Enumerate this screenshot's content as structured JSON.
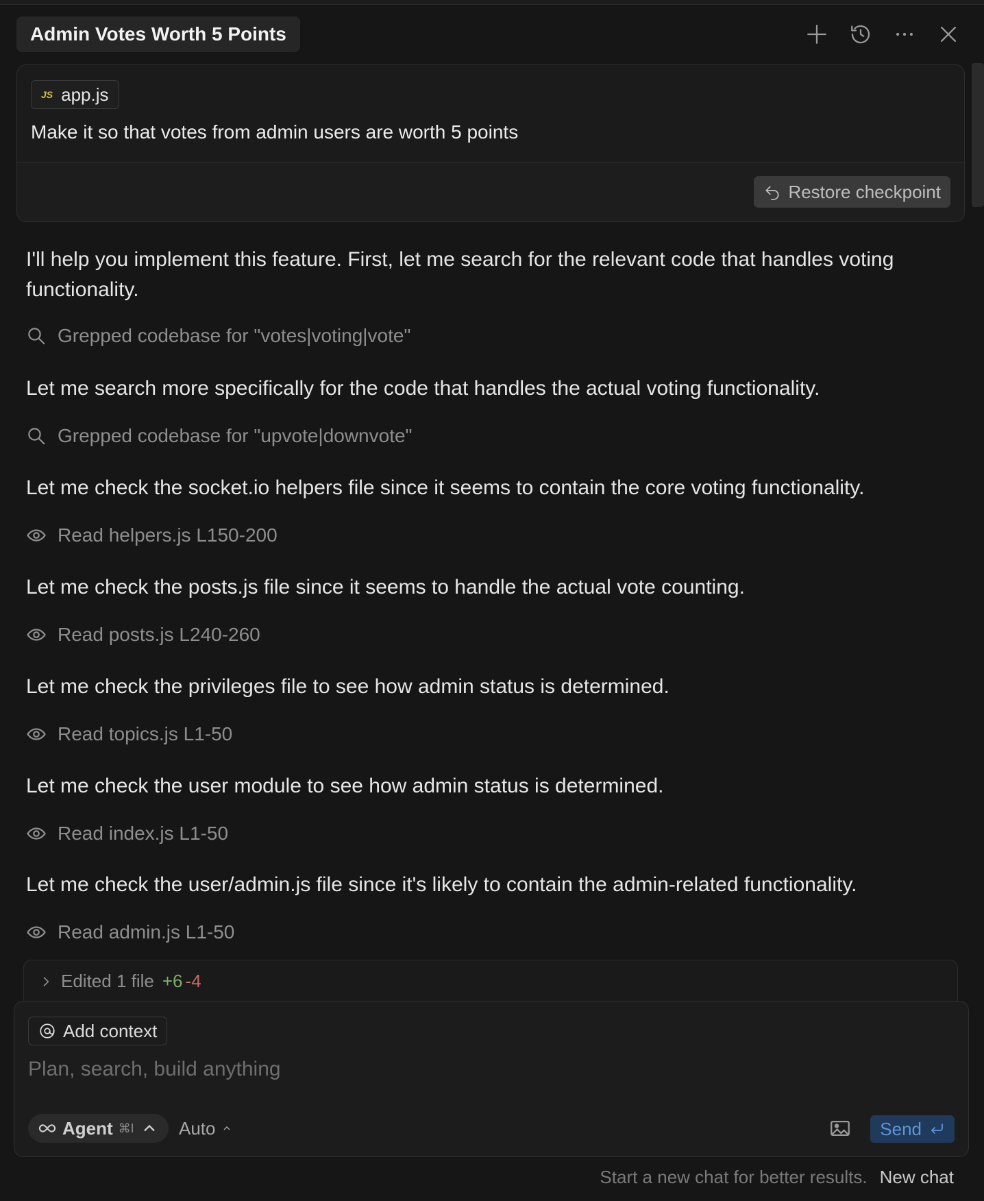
{
  "header": {
    "title": "Admin Votes Worth 5 Points",
    "actions": [
      "plus-icon",
      "history-icon",
      "more-icon",
      "close-icon"
    ]
  },
  "user_message": {
    "file_chip": {
      "badge": "JS",
      "name": "app.js"
    },
    "text": "Make it so that votes from admin users are worth 5 points",
    "restore_label": "Restore checkpoint"
  },
  "conversation": {
    "m1": "I'll help you implement this feature. First, let me search for the relevant code that handles voting functionality.",
    "t1": "Grepped codebase for \"votes|voting|vote\"",
    "m2": "Let me search more specifically for the code that handles the actual voting functionality.",
    "t2": "Grepped codebase for \"upvote|downvote\"",
    "m3": "Let me check the socket.io helpers file since it seems to contain the core voting functionality.",
    "t3": "Read helpers.js L150-200",
    "m4": "Let me check the posts.js file since it seems to handle the actual vote counting.",
    "t4": "Read posts.js L240-260",
    "m5": "Let me check the privileges file to see how admin status is determined.",
    "t5": "Read topics.js L1-50",
    "m6": "Let me check the user module to see how admin status is determined.",
    "t6": "Read index.js L1-50",
    "m7": "Let me check the user/admin.js file since it's likely to contain the admin-related functionality.",
    "t7": "Read admin.js L1-50"
  },
  "edited": {
    "label": "Edited 1 file",
    "additions": "+6",
    "deletions": "-4"
  },
  "composer": {
    "add_context": "Add context",
    "placeholder": "Plan, search, build anything",
    "agent_label": "Agent",
    "agent_shortcut": "⌘I",
    "model_label": "Auto",
    "send_label": "Send"
  },
  "footer": {
    "hint": "Start a new chat for better results.",
    "new_chat": "New chat"
  },
  "colors": {
    "background": "#161616",
    "additions": "#7fae6a",
    "deletions": "#c46a6a",
    "send_bg": "#1f3a5c",
    "send_text": "#5e95d6"
  }
}
